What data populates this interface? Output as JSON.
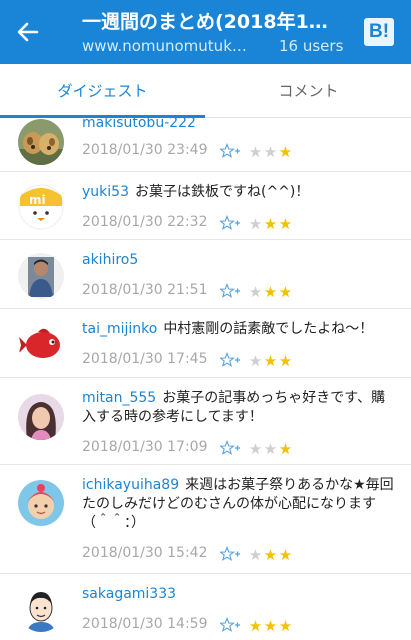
{
  "header": {
    "title": "一週間のまとめ(2018年1…",
    "url": "www.nomunomutuk…",
    "users": "16 users",
    "logo": "B!",
    "back_icon": "back-arrow-icon",
    "color": "#1a85d6"
  },
  "tabs": [
    {
      "label": "ダイジェスト",
      "active": true
    },
    {
      "label": "コメント",
      "active": false
    }
  ],
  "comments": [
    {
      "user": "makisutobu-222",
      "text": "",
      "date": "2018/01/30 23:49",
      "stars_total": 3,
      "stars_lit": 1,
      "avatar": "dogs-avatar"
    },
    {
      "user": "yuki53",
      "text": "お菓子は鉄板ですね(^^)！",
      "date": "2018/01/30 22:32",
      "stars_total": 3,
      "stars_lit": 2,
      "avatar": "mi-logo-avatar"
    },
    {
      "user": "akihiro5",
      "text": "",
      "date": "2018/01/30 21:51",
      "stars_total": 3,
      "stars_lit": 2,
      "avatar": "person-avatar"
    },
    {
      "user": "tai_mijinko",
      "text": "中村憲剛の話素敵でしたよね〜！",
      "date": "2018/01/30 17:45",
      "stars_total": 3,
      "stars_lit": 2,
      "avatar": "red-fish-avatar"
    },
    {
      "user": "mitan_555",
      "text": "お菓子の記事めっちゃ好きです、購入する時の参考にしてます！",
      "date": "2018/01/30 17:09",
      "stars_total": 3,
      "stars_lit": 1,
      "avatar": "woman-avatar"
    },
    {
      "user": "ichikayuiha89",
      "text": "来週はお菓子祭りあるかな★毎回たのしみだけどのむさんの体が心配になります（＾＾：）",
      "date": "2018/01/30 15:42",
      "stars_total": 3,
      "stars_lit": 2,
      "avatar": "baby-avatar"
    },
    {
      "user": "sakagami333",
      "text": "",
      "date": "2018/01/30 14:59",
      "stars_total": 3,
      "stars_lit": 3,
      "avatar": "cartoon-man-avatar"
    }
  ],
  "colors": {
    "accent": "#1a85d6",
    "star_on": "#f2c200",
    "star_off": "#cfcfcf",
    "date": "#a8a8a8"
  }
}
